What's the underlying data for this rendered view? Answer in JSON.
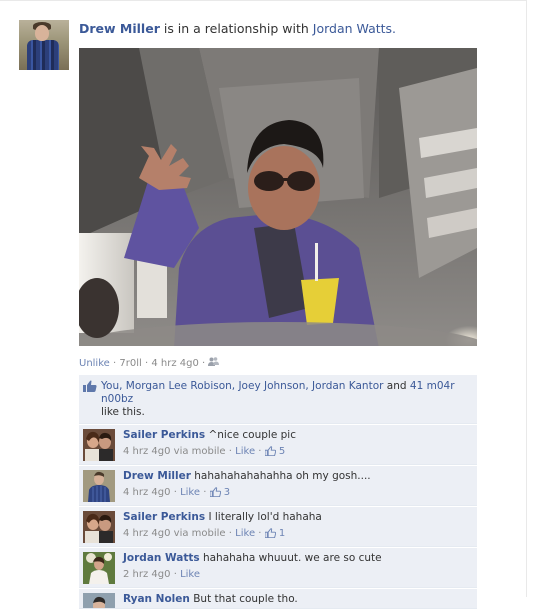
{
  "story": {
    "actor": "Drew Miller",
    "verb": "is in a relationship with",
    "partner": "Jordan Watts."
  },
  "meta": {
    "unlike": "Unlike",
    "dot1": "·",
    "tag": "7r0ll",
    "dot2": "·",
    "time": "4 hrz 4g0",
    "dot3": "·"
  },
  "likes": {
    "names": "You, Morgan Lee Robison, Joey Johnson, Jordan Kantor",
    "and": "and",
    "others": "41 m04r n00bz",
    "suffix": "like this."
  },
  "comments": [
    {
      "author": "Sailer Perkins",
      "text": "^nice couple pic",
      "time": "4 hrz 4g0 via mobile",
      "like_label": "Like",
      "sep": "·",
      "likes": "5"
    },
    {
      "author": "Drew Miller",
      "text": "hahahahahahahha oh my gosh....",
      "time": "4 hrz 4g0",
      "like_label": "Like",
      "sep": "·",
      "likes": "3"
    },
    {
      "author": "Sailer Perkins",
      "text": "I literally lol'd hahaha",
      "time": "4 hrz 4g0 via mobile",
      "like_label": "Like",
      "sep": "·",
      "likes": "1"
    },
    {
      "author": "Jordan Watts",
      "text": "hahahaha whuuut. we are so cute",
      "time": "2 hrz 4g0",
      "like_label": "Like",
      "sep": "·"
    },
    {
      "author": "Ryan Nolen",
      "text": "But that couple tho."
    }
  ],
  "colors": {
    "link": "#3b5998",
    "ufi_bg": "#eceff5",
    "meta_text": "#8a8a8a"
  },
  "icons": {
    "friends": "friends-icon",
    "thumb": "thumbs-up-icon"
  }
}
